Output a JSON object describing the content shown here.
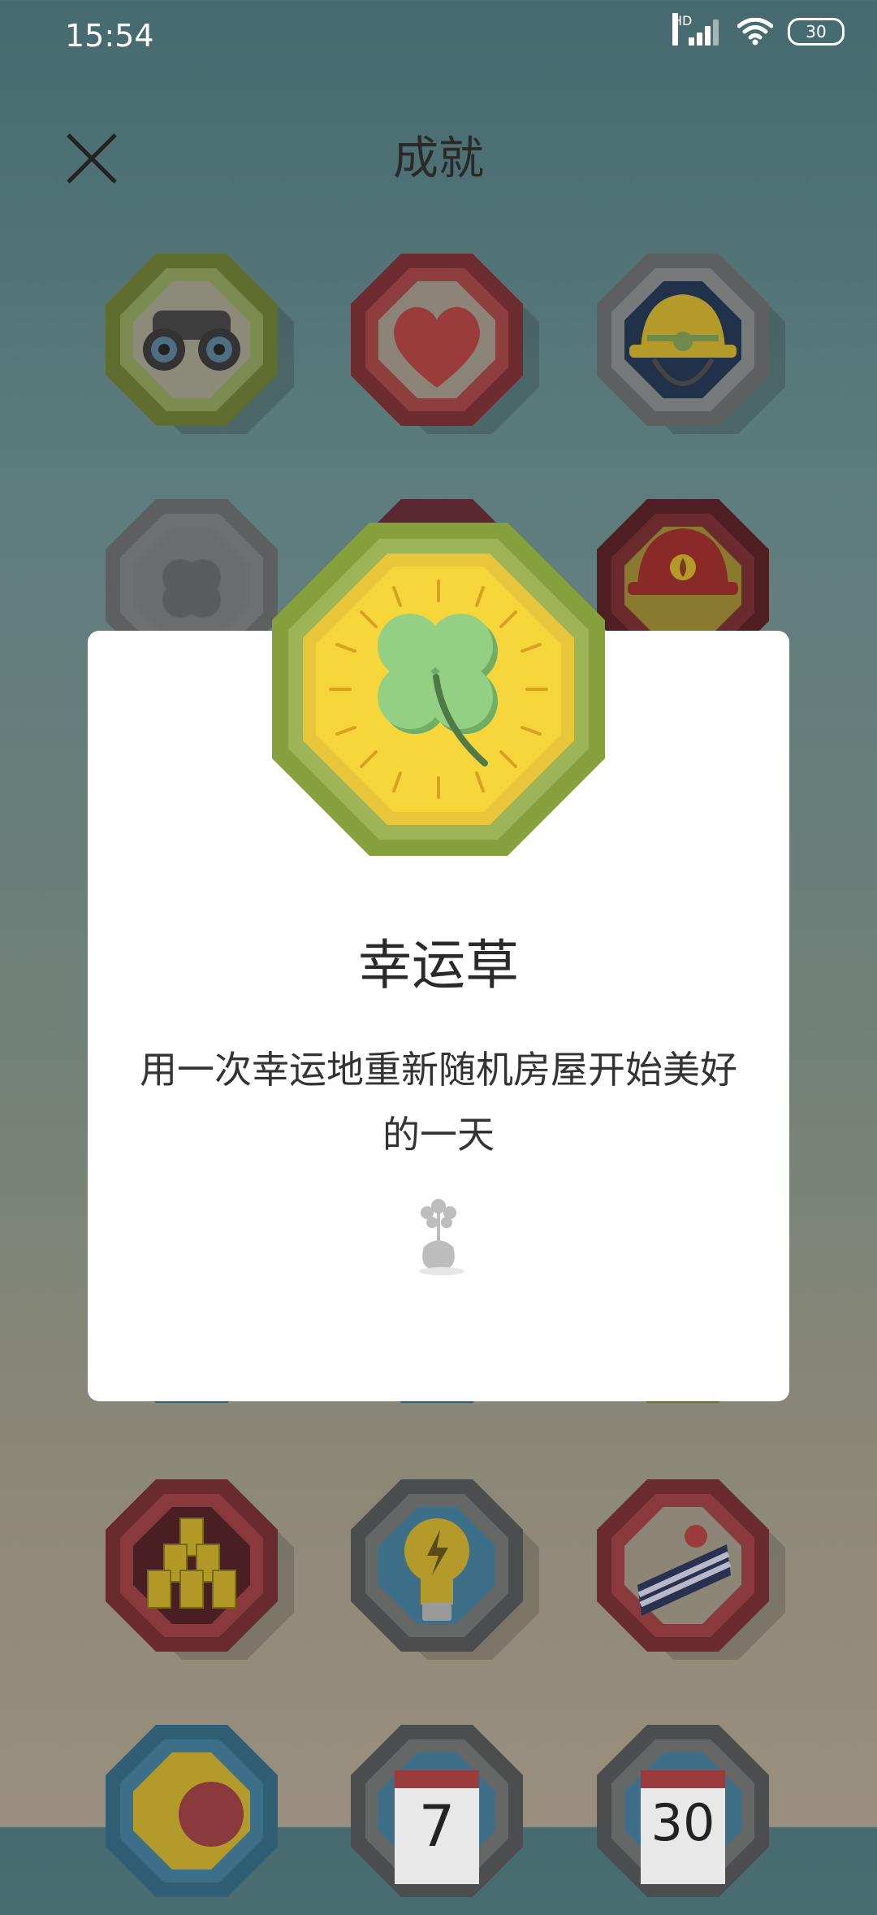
{
  "status_bar": {
    "time": "15:54",
    "hd_label": "HD",
    "battery": "30"
  },
  "header": {
    "title": "成就"
  },
  "background_badges": [
    {
      "name": "binoculars-badge",
      "icon": "binoculars"
    },
    {
      "name": "heart-badge",
      "icon": "heart"
    },
    {
      "name": "hardhat-badge",
      "icon": "hard-hat"
    },
    {
      "name": "clover-badge-locked",
      "icon": "clover"
    },
    {
      "name": "hidden-badge",
      "icon": "unknown"
    },
    {
      "name": "fire-helmet-badge",
      "icon": "fire-helmet"
    },
    {
      "name": "gold-bars-badge",
      "icon": "gold-bars"
    },
    {
      "name": "lightbulb-badge",
      "icon": "lightbulb"
    },
    {
      "name": "cake-badge",
      "icon": "cake"
    },
    {
      "name": "beach-ball-badge",
      "icon": "beach-ball"
    },
    {
      "name": "calendar-7-badge",
      "icon": "calendar",
      "label": "7"
    },
    {
      "name": "calendar-30-badge",
      "icon": "calendar",
      "label": "30"
    }
  ],
  "dialog": {
    "badge_icon": "four-leaf-clover",
    "title": "幸运草",
    "description": "用一次幸运地重新随机房屋开始美好的一天",
    "footer_icon": "plant-vase-icon"
  },
  "colors": {
    "accent_gold": "#f4d23a",
    "clover_green": "#8fce7e",
    "badge_frame_green": "#9db457"
  }
}
